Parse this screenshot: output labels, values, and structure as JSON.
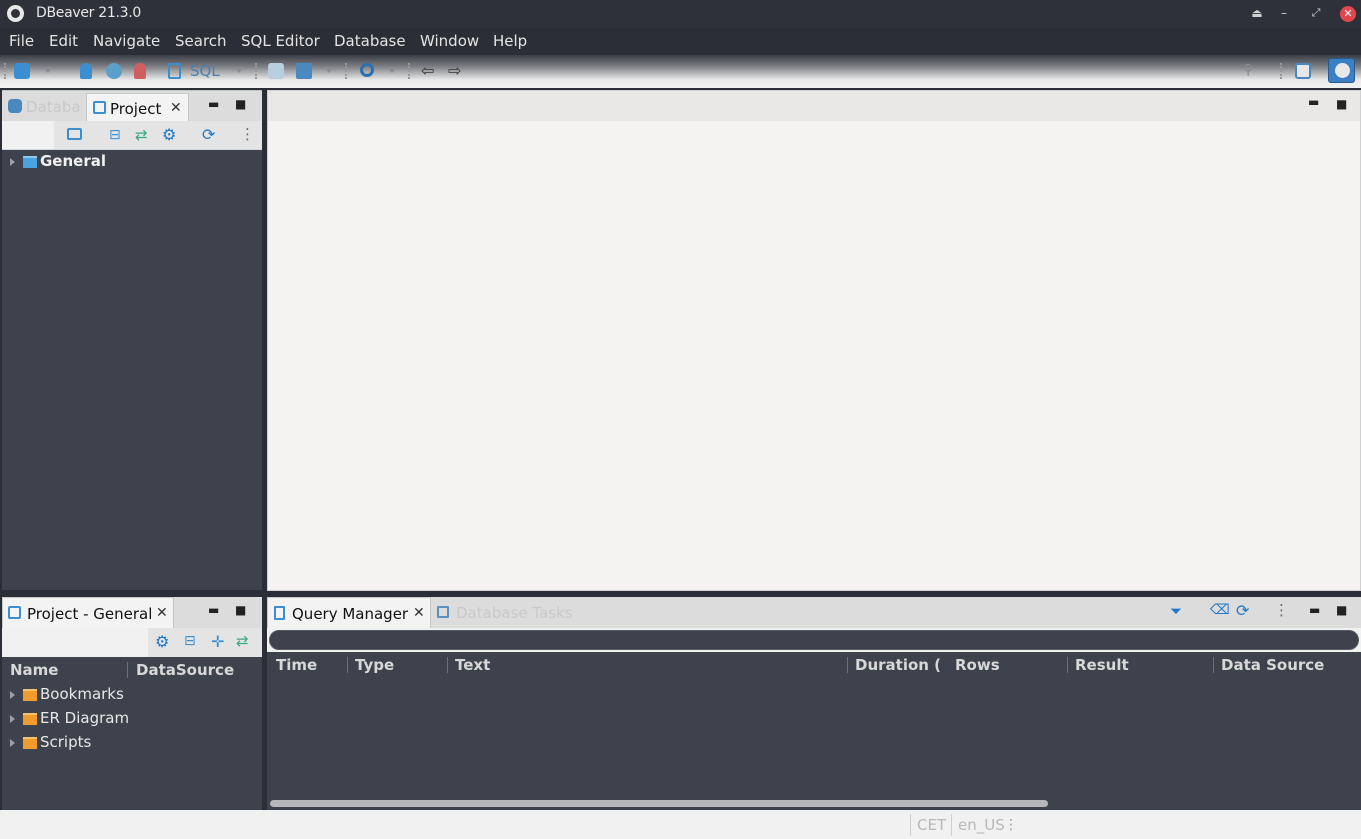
{
  "window": {
    "title": "DBeaver 21.3.0"
  },
  "menubar": {
    "items": [
      "File",
      "Edit",
      "Navigate",
      "Search",
      "SQL Editor",
      "Database",
      "Window",
      "Help"
    ]
  },
  "toolbar": {
    "sql_label": "SQL"
  },
  "navigator": {
    "tabs": [
      {
        "label": "Databa",
        "active": false,
        "icon": "database-icon"
      },
      {
        "label": "Project",
        "active": true,
        "icon": "project-icon"
      }
    ],
    "tree": [
      {
        "label": "General",
        "expanded": false,
        "icon": "folder-icon"
      }
    ]
  },
  "project_panel": {
    "tab_label": "Project - General",
    "columns": [
      "Name",
      "DataSource"
    ],
    "items": [
      {
        "label": "Bookmarks",
        "icon": "bookmarks-folder-icon"
      },
      {
        "label": "ER Diagram",
        "icon": "er-diagram-folder-icon"
      },
      {
        "label": "Scripts",
        "icon": "scripts-folder-icon"
      }
    ]
  },
  "query_manager": {
    "tabs": [
      {
        "label": "Query Manager",
        "active": true
      },
      {
        "label": "Database Tasks",
        "active": false
      }
    ],
    "columns": [
      "Time",
      "Type",
      "Text",
      "Duration ( m",
      "Rows",
      "Result",
      "Data Source"
    ]
  },
  "statusbar": {
    "timezone": "CET",
    "locale": "en_US"
  },
  "colors": {
    "dark_bg": "#2b2e36",
    "tree_bg": "#3e424c",
    "accent": "#4aa3df",
    "close": "#e0464b"
  }
}
